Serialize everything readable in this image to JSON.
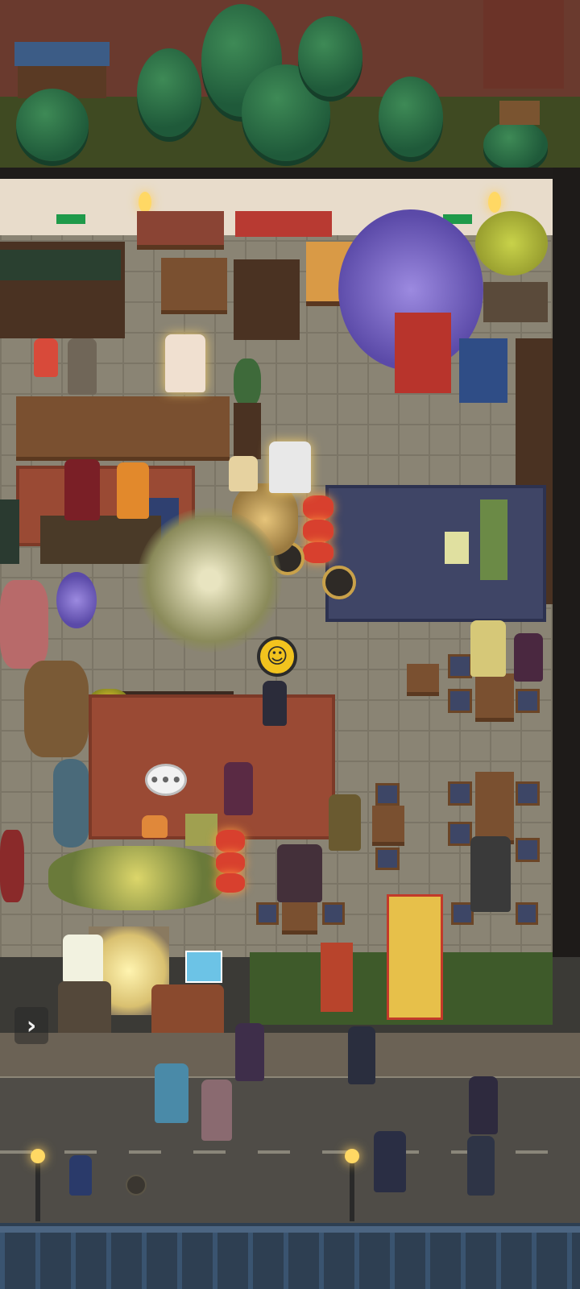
{
  "ui": {
    "chat_bubble_text": "•••",
    "emoji_symbol": "☺",
    "expand_symbol": "›"
  },
  "icons": {
    "chat": "speech-bubble-icon",
    "emoji": "smiley-face-icon",
    "expand": "chevron-right-icon"
  },
  "colors": {
    "floor": "#8a8474",
    "rug_red": "#9a4a34",
    "rug_blue": "#3f4566",
    "lantern": "#d8402e",
    "emoji_bubble": "#f2c31e"
  }
}
